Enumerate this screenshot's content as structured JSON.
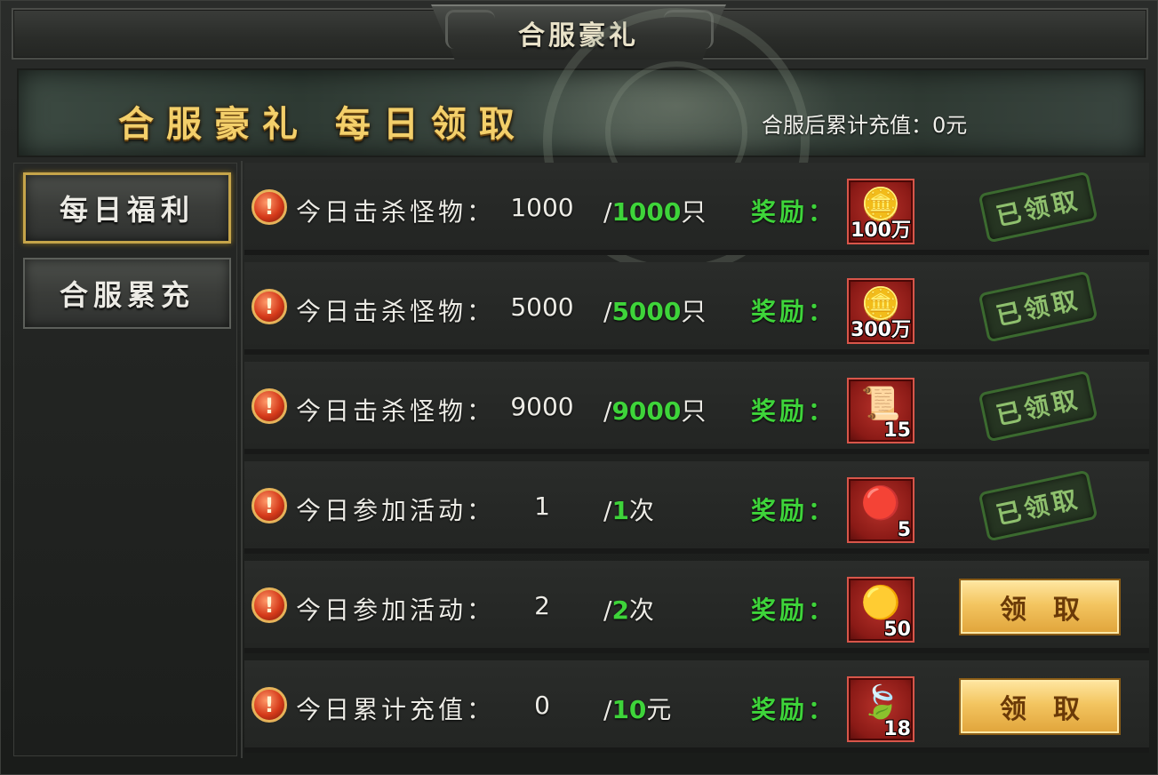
{
  "window": {
    "title": "合服豪礼"
  },
  "banner": {
    "title": "合服豪礼 每日领取",
    "stat_text": "合服后累计充值：0元"
  },
  "sidebar": {
    "tabs": [
      {
        "label": "每日福利",
        "active": true
      },
      {
        "label": "合服累充",
        "active": false
      }
    ]
  },
  "reward_label": "奖励：",
  "rows": [
    {
      "task": "今日击杀怪物：",
      "current": "1000",
      "target_prefix": "/",
      "target": "1000",
      "unit": "只",
      "item_icon": "gold-ingot-icon",
      "item_qty": "100万",
      "status": "claimed",
      "status_label": "已领取"
    },
    {
      "task": "今日击杀怪物：",
      "current": "5000",
      "target_prefix": "/",
      "target": "5000",
      "unit": "只",
      "item_icon": "gold-ingot-icon",
      "item_qty": "300万",
      "status": "claimed",
      "status_label": "已领取"
    },
    {
      "task": "今日击杀怪物：",
      "current": "9000",
      "target_prefix": "/",
      "target": "9000",
      "unit": "只",
      "item_icon": "scroll-icon",
      "item_qty": "15",
      "status": "claimed",
      "status_label": "已领取"
    },
    {
      "task": "今日参加活动：",
      "current": "1",
      "target_prefix": "/",
      "target": "1",
      "unit": "次",
      "item_icon": "red-orb-icon",
      "item_qty": "5",
      "status": "claimed",
      "status_label": "已领取"
    },
    {
      "task": "今日参加活动：",
      "current": "2",
      "target_prefix": "/",
      "target": "2",
      "unit": "次",
      "item_icon": "gold-coin-icon",
      "item_qty": "50",
      "status": "claimable",
      "status_label": "领取"
    },
    {
      "task": "今日累计充值：",
      "current": "0",
      "target_prefix": "/",
      "target": "10",
      "unit": "元",
      "item_icon": "green-leaf-icon",
      "item_qty": "18",
      "status": "claimable",
      "status_label": "领取"
    }
  ],
  "colors": {
    "accent_green": "#3ed43a",
    "gold_text": "#f3cf6a",
    "claim_button": "#f3c560",
    "item_frame": "#b8322a"
  }
}
